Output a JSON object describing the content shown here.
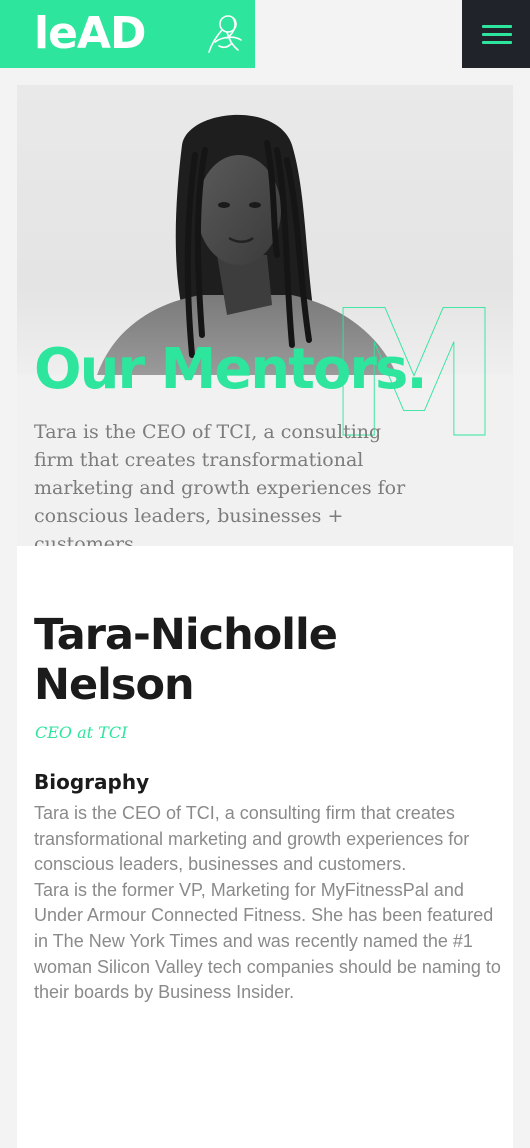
{
  "header": {
    "logo_text": "leAD",
    "logo_mark_icon": "ribbon-monogram-icon",
    "menu_icon": "hamburger-menu-icon"
  },
  "hero": {
    "title": "Our Mentors.",
    "description": "Tara is the CEO of TCI, a consulting firm that creates transformational marketing and growth experiences for conscious leaders, businesses + customers.",
    "decorative_letter": "M"
  },
  "mentor": {
    "name": "Tara-Nicholle Nelson",
    "role": "CEO at TCI",
    "bio_heading": "Biography",
    "bio_paragraphs": [
      "Tara is the CEO of TCI, a consulting firm that creates transformational marketing and growth experiences for conscious leaders, businesses and customers.",
      "Tara is the former VP, Marketing for MyFitnessPal and Under Armour Connected Fitness. She has been featured in The New York Times and was recently named the #1 woman Silicon Valley tech companies should be naming to their boards by Business Insider."
    ]
  },
  "colors": {
    "accent": "#2ee59d",
    "dark": "#21232a",
    "text_gray": "#8a8a8a",
    "heading": "#1b1b1b"
  }
}
